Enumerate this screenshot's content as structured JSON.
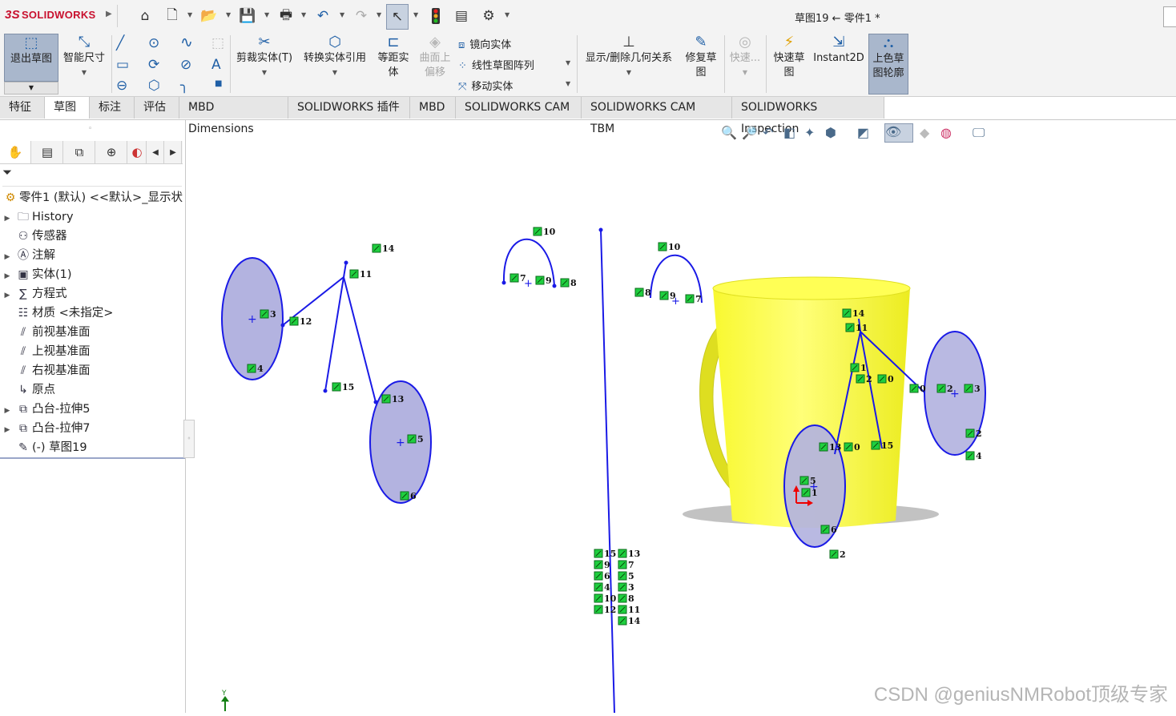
{
  "titlebar": {
    "brand": "SOLIDWORKS",
    "brand_prefix": "3S",
    "document_title": "草图19 ← 零件1 *",
    "quick_access_icons": [
      "home-icon",
      "new-document-icon",
      "open-icon",
      "save-icon",
      "print-icon",
      "undo-icon",
      "redo-icon",
      "select-pointer-icon",
      "traffic-light-icon",
      "file-properties-icon",
      "options-gear-icon"
    ]
  },
  "command_manager": {
    "exit_sketch": "退出草图",
    "smart_dimension": "智能尺寸",
    "trim_entities": "剪裁实体(T)",
    "convert_entities": "转换实体引用",
    "offset_entities": "等距实体",
    "offset_on_surface": "曲面上偏移",
    "mirror_entities": "镜向实体",
    "linear_pattern": "线性草图阵列",
    "move_entities": "移动实体",
    "display_relations": "显示/删除几何关系",
    "repair_sketch": "修复草图",
    "quick_snaps": "快速...",
    "rapid_sketch": "快速草图",
    "instant2d": "Instant2D",
    "shaded_contours": "上色草图轮廓"
  },
  "tabs": [
    "特征",
    "草图",
    "标注",
    "评估",
    "MBD Dimensions",
    "SOLIDWORKS 插件",
    "MBD",
    "SOLIDWORKS CAM",
    "SOLIDWORKS CAM TBM",
    "SOLIDWORKS Inspection"
  ],
  "active_tab": "草图",
  "feature_tree": {
    "root": "零件1 (默认) <<默认>_显示状",
    "items": [
      {
        "label": "History",
        "expandable": true,
        "icon": "history-folder-icon"
      },
      {
        "label": "传感器",
        "expandable": false,
        "icon": "sensors-folder-icon"
      },
      {
        "label": "注解",
        "expandable": true,
        "icon": "annotations-icon"
      },
      {
        "label": "实体(1)",
        "expandable": true,
        "icon": "solid-bodies-icon"
      },
      {
        "label": "方程式",
        "expandable": true,
        "icon": "equations-icon"
      },
      {
        "label": "材质 <未指定>",
        "expandable": false,
        "icon": "material-icon"
      },
      {
        "label": "前视基准面",
        "expandable": false,
        "icon": "plane-icon"
      },
      {
        "label": "上视基准面",
        "expandable": false,
        "icon": "plane-icon"
      },
      {
        "label": "右视基准面",
        "expandable": false,
        "icon": "plane-icon"
      },
      {
        "label": "原点",
        "expandable": false,
        "icon": "origin-icon"
      },
      {
        "label": "凸台-拉伸5",
        "expandable": true,
        "icon": "boss-extrude-icon"
      },
      {
        "label": "凸台-拉伸7",
        "expandable": true,
        "icon": "boss-extrude-icon"
      },
      {
        "label": "(-) 草图19",
        "expandable": false,
        "icon": "sketch-icon"
      }
    ]
  },
  "viewport": {
    "axis_label": "Y",
    "watermark": "CSDN @geniusNMRobot顶级专家",
    "sketch_color": "#1a1ae6",
    "fill_color": "#b3b3e0",
    "model_color": "#ffff3c",
    "markers": {
      "group_a": [
        "14",
        "11",
        "3",
        "12",
        "4",
        "15",
        "13",
        "5",
        "6"
      ],
      "group_b": [
        "10",
        "7",
        "9",
        "8"
      ],
      "group_c": [
        "10",
        "8",
        "9",
        "7"
      ],
      "column_left": [
        "15",
        "9",
        "6",
        "4",
        "10",
        "12"
      ],
      "column_right": [
        "13",
        "7",
        "5",
        "3",
        "8",
        "11",
        "14"
      ],
      "mug": [
        "14",
        "11",
        "1",
        "2",
        "0",
        "0",
        "2",
        "3",
        "2",
        "4",
        "13",
        "0",
        "5",
        "1",
        "6",
        "2",
        "15"
      ]
    }
  }
}
